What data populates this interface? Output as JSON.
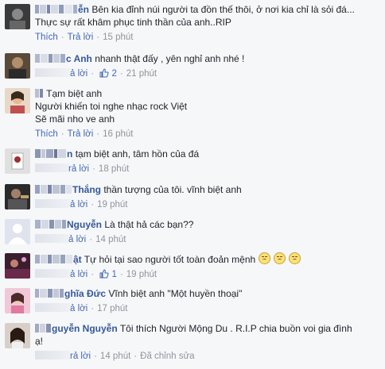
{
  "actions": {
    "like": "Thích",
    "reply": "Trả lời",
    "reply_partial": "ả lời",
    "reply_partial2": "rả lời",
    "edited": "Đã chỉnh sửa"
  },
  "comments": [
    {
      "name": "ễn",
      "text_line1": "Bên kia đỉnh núi người ta đồn thế thôi, ở nơi kia chỉ là sỏi đá...",
      "text_line2": "Thực sự rất khâm phục tinh thần của anh..RIP",
      "time": "15 phút"
    },
    {
      "name": "c Anh",
      "text_line1": "nhanh thật đấy , yên nghỉ anh nhé !",
      "likes": "2",
      "time": "21 phút"
    },
    {
      "text_line1": "Tạm biệt anh",
      "text_line2": "Người khiến toi nghe nhạc rock Việt",
      "text_line3": "Sẽ mãi nho ve anh",
      "time": "16 phút"
    },
    {
      "name": "n",
      "text_line1": "tạm biệt anh, tâm hồn của đá",
      "time": "18 phút"
    },
    {
      "name": "Thắng",
      "text_line1": "thần tượng của tôi. vĩnh biệt anh",
      "time": "19 phút"
    },
    {
      "name": "Nguyễn",
      "text_line1": "Là thật hả các bạn??",
      "time": "14 phút"
    },
    {
      "name": "ật",
      "text_line1": "Tự hỏi tại sao người tốt toàn đoản mệnh",
      "likes": "1",
      "time": "19 phút"
    },
    {
      "name": "ghĩa Đức",
      "text_line1": "Vĩnh biệt anh \"Một huyền thoại\"",
      "time": "17 phút"
    },
    {
      "name": "guyễn Nguyễn",
      "text_line1": "Tôi thích Người Mộng Du . R.I.P chia buồn voi gia đình",
      "text_line2": "ạ!",
      "time": "14 phút"
    }
  ]
}
